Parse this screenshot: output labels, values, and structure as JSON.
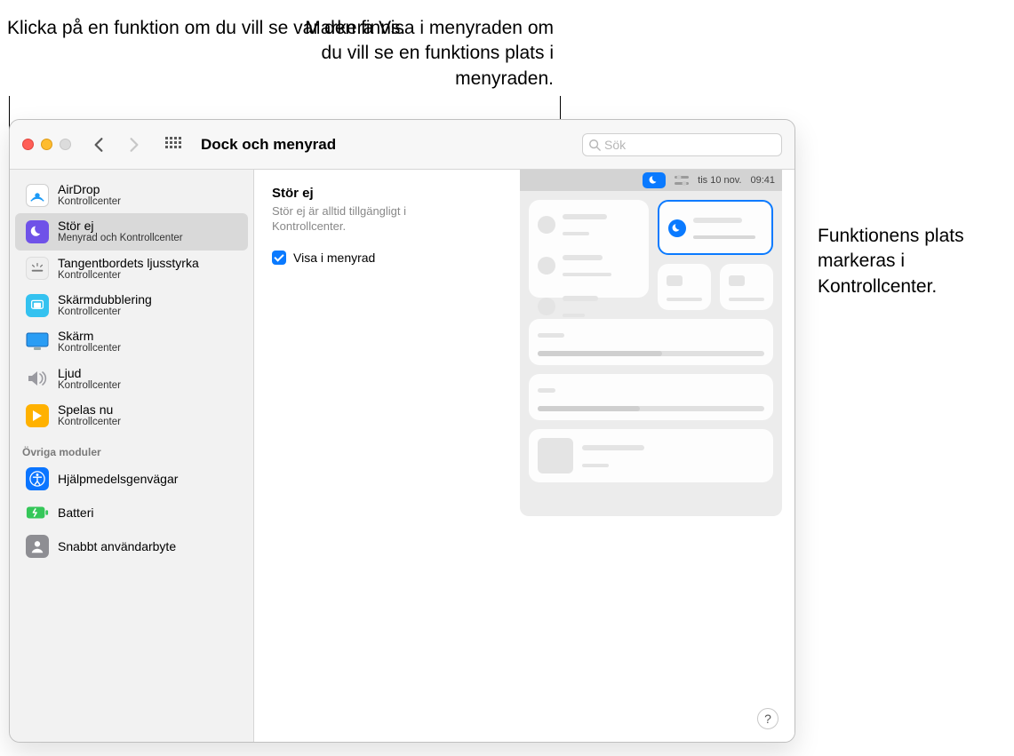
{
  "callouts": {
    "left": "Klicka på en funktion om du vill se var den finns.",
    "mid": "Markera Visa i menyraden om du vill se en funktions plats i menyraden.",
    "right": "Funktionens plats markeras i Kontrollcenter."
  },
  "toolbar": {
    "title": "Dock och menyrad",
    "search_placeholder": "Sök"
  },
  "sidebar": {
    "items": [
      {
        "title": "AirDrop",
        "sub": "Kontrollcenter",
        "icon": "airdrop"
      },
      {
        "title": "Stör ej",
        "sub": "Menyrad och Kontrollcenter",
        "icon": "dnd"
      },
      {
        "title": "Tangentbordets ljusstyrka",
        "sub": "Kontrollcenter",
        "icon": "keyboard"
      },
      {
        "title": "Skärmdubblering",
        "sub": "Kontrollcenter",
        "icon": "mirror"
      },
      {
        "title": "Skärm",
        "sub": "Kontrollcenter",
        "icon": "display"
      },
      {
        "title": "Ljud",
        "sub": "Kontrollcenter",
        "icon": "sound"
      },
      {
        "title": "Spelas nu",
        "sub": "Kontrollcenter",
        "icon": "playing"
      }
    ],
    "section_label": "Övriga moduler",
    "other": [
      {
        "title": "Hjälpmedelsgenvägar",
        "icon": "accessibility"
      },
      {
        "title": "Batteri",
        "icon": "battery"
      },
      {
        "title": "Snabbt användarbyte",
        "icon": "user"
      }
    ],
    "selected_index": 1
  },
  "detail": {
    "heading": "Stör ej",
    "subtext": "Stör ej är alltid tillgängligt i Kontrollcenter.",
    "checkbox_label": "Visa i menyrad",
    "checkbox_checked": true
  },
  "preview": {
    "menubar_date": "tis 10 nov.",
    "menubar_time": "09:41"
  },
  "help_label": "?"
}
